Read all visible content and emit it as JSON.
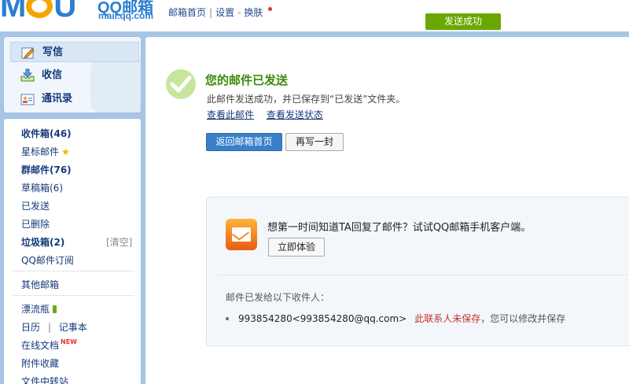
{
  "header": {
    "brand_logo": "MOU",
    "brand_name": "QQ邮箱",
    "brand_domain": "mail.qq.com",
    "links": [
      "邮箱首页",
      "设置",
      "换肤"
    ],
    "separators": [
      "|",
      "-"
    ],
    "status": "发送成功"
  },
  "sidebar": {
    "top_items": [
      {
        "label": "写信",
        "icon": "compose-pencil-icon"
      },
      {
        "label": "收信",
        "icon": "inbox-download-icon"
      },
      {
        "label": "通讯录",
        "icon": "contacts-card-icon"
      }
    ],
    "folders": [
      {
        "label": "收件箱(46)",
        "bold": true
      },
      {
        "label": "星标邮件",
        "icon": "star-icon"
      },
      {
        "label": "群邮件(76)",
        "bold": true
      },
      {
        "label": "草稿箱(6)"
      },
      {
        "label": "已发送"
      },
      {
        "label": "已删除"
      },
      {
        "label": "垃圾箱(2)",
        "bold": true,
        "action": "[清空]"
      },
      {
        "label": "QQ邮件订阅"
      }
    ],
    "other": "其他邮箱",
    "apps": [
      {
        "label": "漂流瓶",
        "icon": "bottle-icon"
      },
      {
        "label": "日历",
        "extra": "记事本"
      },
      {
        "label": "在线文档",
        "badge": "NEW"
      },
      {
        "label": "附件收藏"
      },
      {
        "label": "文件中转站"
      }
    ],
    "app_sep": "|"
  },
  "main": {
    "title": "您的邮件已发送",
    "desc": "此邮件发送成功，并已保存到“已发送”文件夹。",
    "links": [
      "查看此邮件",
      "查看发送状态"
    ],
    "buttons": {
      "back": "返回邮箱首页",
      "rewrite": "再写一封"
    },
    "promo": {
      "text": "想第一时间知道TA回复了邮件？试试QQ邮箱手机客户端。",
      "button": "立即体验"
    },
    "recipients_label": "邮件已发给以下收件人：",
    "recipient": {
      "address": "993854280<993854280@qq.com>",
      "warning": "此联系人未保存",
      "hint": "，您可以修改并保存"
    }
  },
  "colors": {
    "brand_blue": "#2a7fd1",
    "success_green": "#6aa700",
    "title_green": "#3c8a0f",
    "primary_button": "#3a80c9",
    "warning_red": "#c0322b"
  }
}
